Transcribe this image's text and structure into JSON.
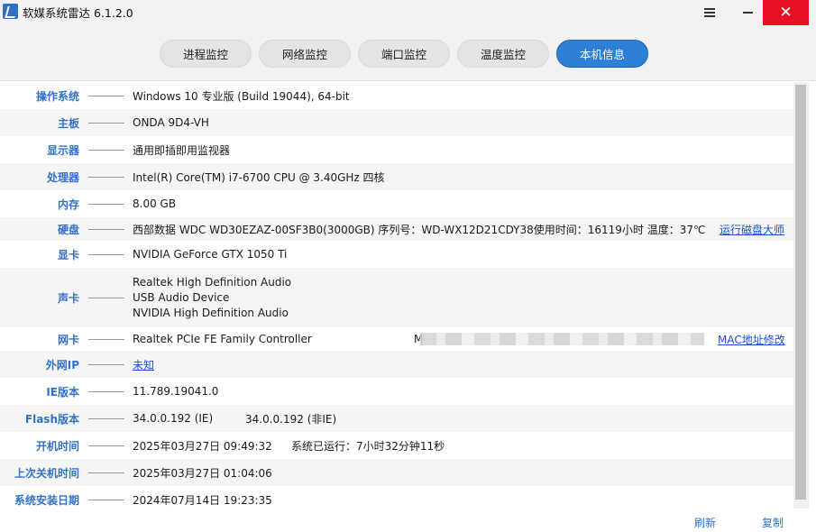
{
  "app": {
    "title": "软媒系统雷达 6.1.2.0",
    "close_symbol": "✕"
  },
  "tabs": [
    {
      "label": "进程监控",
      "active": false
    },
    {
      "label": "网络监控",
      "active": false
    },
    {
      "label": "端口监控",
      "active": false
    },
    {
      "label": "温度监控",
      "active": false
    },
    {
      "label": "本机信息",
      "active": true
    }
  ],
  "info": {
    "os": {
      "label": "操作系统",
      "value": "Windows 10 专业版 (Build 19044), 64-bit"
    },
    "board": {
      "label": "主板",
      "value": "ONDA 9D4-VH"
    },
    "monitor": {
      "label": "显示器",
      "value": "通用即插即用监视器"
    },
    "cpu": {
      "label": "处理器",
      "value": "Intel(R) Core(TM) i7-6700 CPU @ 3.40GHz 四核"
    },
    "ram": {
      "label": "内存",
      "value": "8.00 GB"
    },
    "disk": {
      "label": "硬盘",
      "value": "西部数据 WDC WD30EZAZ-00SF3B0(3000GB)   序列号：WD-WX12D21CDY38使用时间：16119小时 温度：37℃",
      "link": "运行磁盘大师"
    },
    "gpu": {
      "label": "显卡",
      "value": "NVIDIA GeForce GTX 1050 Ti"
    },
    "audio": {
      "label": "声卡",
      "values": [
        "Realtek High Definition Audio",
        "USB Audio Device",
        "NVIDIA High Definition Audio"
      ]
    },
    "nic": {
      "label": "网卡",
      "value": "Realtek PCIe FE Family Controller",
      "mac_prefix": "M",
      "link": "MAC地址修改"
    },
    "ip": {
      "label": "外网IP",
      "value": "未知"
    },
    "ie": {
      "label": "IE版本",
      "value": "11.789.19041.0"
    },
    "flash": {
      "label": "Flash版本",
      "value": "34.0.0.192  (IE)",
      "value2": "34.0.0.192  (非IE)"
    },
    "boot": {
      "label": "开机时间",
      "value": "2025年03月27日 09:49:32",
      "uptime": "系统已运行：7小时32分钟11秒"
    },
    "shutdown": {
      "label": "上次关机时间",
      "value": "2025年03月27日 01:04:06"
    },
    "install": {
      "label": "系统安装日期",
      "value": "2024年07月14日 19:23:35"
    }
  },
  "footer": {
    "refresh": "刷新",
    "copy": "复制"
  },
  "colors": {
    "accent": "#2e7fd6",
    "label": "#3272c9",
    "link": "#1a4fd6",
    "close": "#e81123"
  }
}
